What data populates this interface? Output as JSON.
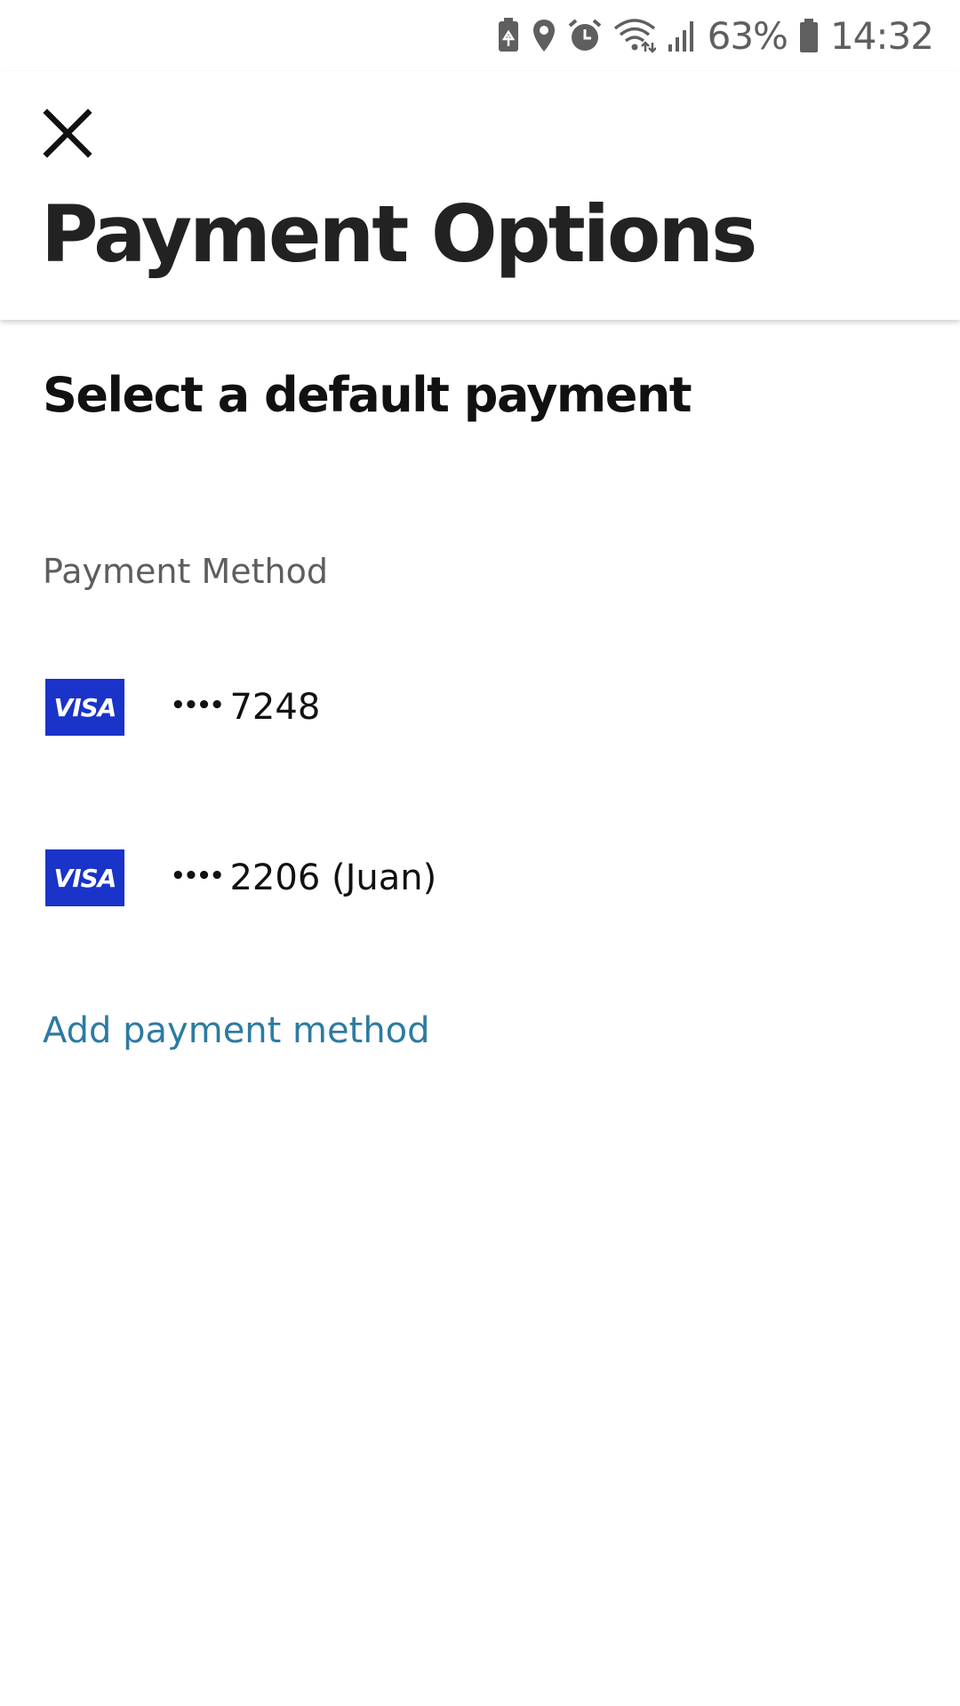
{
  "status_bar": {
    "battery_percent": "63%",
    "time": "14:32",
    "icons": [
      "battery-saver-icon",
      "location-icon",
      "alarm-icon",
      "wifi-icon",
      "signal-icon",
      "battery-icon"
    ]
  },
  "header": {
    "close_icon": "close-icon",
    "title": "Payment Options"
  },
  "main": {
    "section_heading": "Select a default payment",
    "list_label": "Payment Method",
    "payment_methods": [
      {
        "brand": "VISA",
        "masked_dots": "••••",
        "number": "7248"
      },
      {
        "brand": "VISA",
        "masked_dots": "••••",
        "number": "2206 (Juan)"
      }
    ],
    "add_link": "Add payment method"
  },
  "colors": {
    "visa_blue": "#1a33c9",
    "link_blue": "#2c7ba2",
    "title_text": "#222222",
    "secondary_text": "#5e5e5e"
  }
}
